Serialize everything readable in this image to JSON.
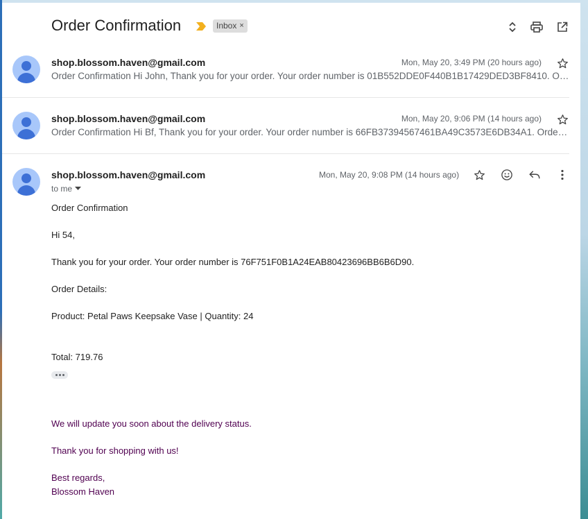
{
  "subject": {
    "title": "Order Confirmation",
    "label": "Inbox",
    "label_remove": "×"
  },
  "messages": [
    {
      "sender": "shop.blossom.haven@gmail.com",
      "time": "Mon, May 20, 3:49 PM (20 hours ago)",
      "snippet": "Order Confirmation Hi John, Thank you for your order. Your order number is 01B552DDE0F440B1B17429DED3BF8410. Order Details: Product: Petal Paws Keepsake Vase"
    },
    {
      "sender": "shop.blossom.haven@gmail.com",
      "time": "Mon, May 20, 9:06 PM (14 hours ago)",
      "snippet": "Order Confirmation Hi Bf, Thank you for your order. Your order number is 66FB37394567461BA49C3573E6DB34A1. Order Details: Product: Petal Paws Keepsake Vase"
    },
    {
      "sender": "shop.blossom.haven@gmail.com",
      "time": "Mon, May 20, 9:08 PM (14 hours ago)",
      "to": "to me"
    }
  ],
  "body": {
    "heading": "Order Confirmation",
    "greeting": "Hi 54,",
    "thanks_order": "Thank you for your order. Your order number is 76F751F0B1A24EAB80423696BB6B6D90.",
    "details_heading": "Order Details:",
    "product_line": "Product: Petal Paws Keepsake Vase | Quantity: 24",
    "total": "Total: 719.76",
    "delivery": "We will update you soon about the delivery status.",
    "shopping_thanks": "Thank you for shopping with us!",
    "regards": "Best regards,",
    "signature": "Blossom Haven"
  },
  "icons": {
    "importance": "importance-marker-icon",
    "expand": "expand-collapse-icon",
    "print": "print-icon",
    "popout": "open-in-new-window-icon",
    "star": "star-icon",
    "emoji": "emoji-icon",
    "reply": "reply-icon",
    "more": "more-vertical-icon"
  },
  "colors": {
    "avatar_bg": "#a8c7fa",
    "avatar_fg": "#3d70d6",
    "importance": "#f2b01e",
    "quoted_text": "#500050"
  }
}
